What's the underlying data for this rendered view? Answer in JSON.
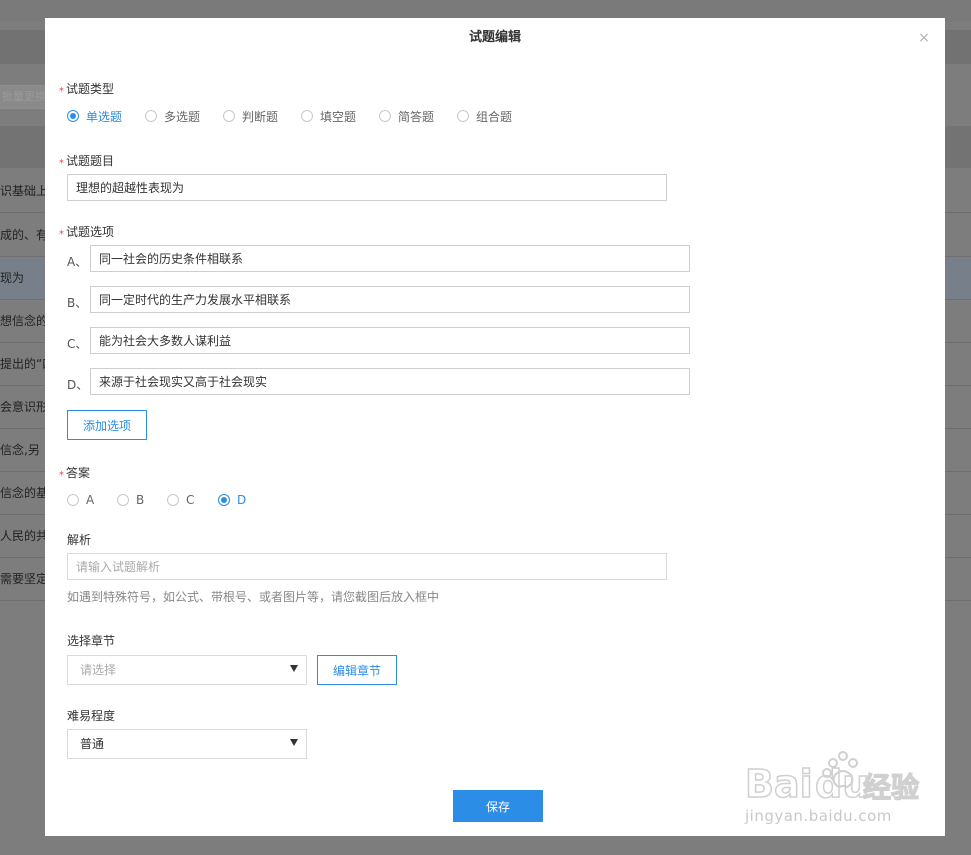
{
  "background": {
    "search_text": "批量更换章节",
    "rows": [
      "识基础上",
      "成的、有",
      "现为",
      "想信念的",
      "提出的“四",
      "会意识形",
      "信念,另",
      "信念的基",
      "人民的共",
      "需要坚定"
    ]
  },
  "dialog": {
    "title": "试题编辑",
    "close_symbol": "×",
    "type_field": {
      "label": "试题类型",
      "options": [
        "单选题",
        "多选题",
        "判断题",
        "填空题",
        "简答题",
        "组合题"
      ],
      "selected": "单选题"
    },
    "question_field": {
      "label": "试题题目",
      "value": "理想的超越性表现为"
    },
    "options_field": {
      "label": "试题选项",
      "items": [
        {
          "letter": "A、",
          "value": "同一社会的历史条件相联系"
        },
        {
          "letter": "B、",
          "value": "同一定时代的生产力发展水平相联系"
        },
        {
          "letter": "C、",
          "value": "能为社会大多数人谋利益"
        },
        {
          "letter": "D、",
          "value": "来源于社会现实又高于社会现实"
        }
      ],
      "add_button": "添加选项"
    },
    "answer_field": {
      "label": "答案",
      "options": [
        "A",
        "B",
        "C",
        "D"
      ],
      "selected": "D"
    },
    "analysis_field": {
      "label": "解析",
      "placeholder": "请输入试题解析",
      "value": "",
      "hint": "如遇到特殊符号，如公式、带根号、或者图片等，请您截图后放入框中"
    },
    "chapter_field": {
      "label": "选择章节",
      "placeholder": "请选择",
      "edit_button": "编辑章节"
    },
    "difficulty_field": {
      "label": "难易程度",
      "value": "普通"
    },
    "save_button": "保存"
  },
  "watermark": {
    "logo_text": "Baidu经验",
    "url_text": "jingyan.baidu.com"
  },
  "colors": {
    "accent": "#2b8de6",
    "required_mark": "#e24a4a",
    "overlay": "#7d7d7d"
  }
}
